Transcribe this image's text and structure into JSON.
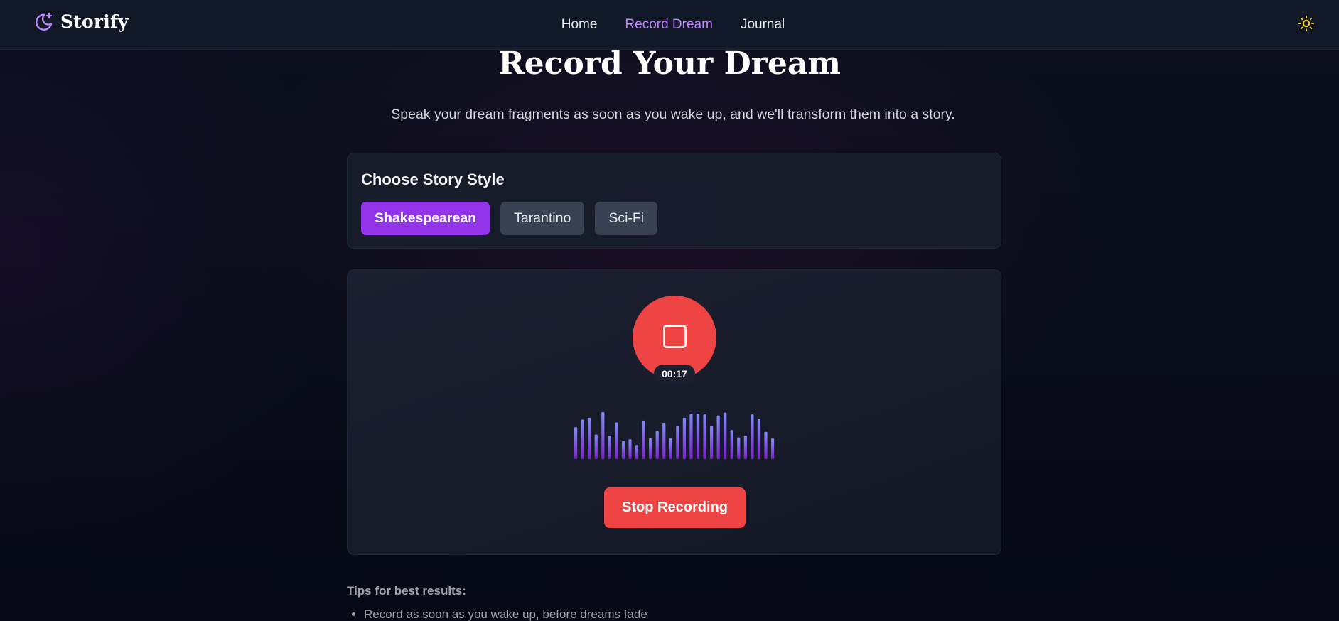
{
  "brand": {
    "name": "Storify",
    "icon": "moon-sparkle-icon",
    "color": "#c084fc"
  },
  "nav": {
    "items": [
      {
        "label": "Home",
        "active": false
      },
      {
        "label": "Record Dream",
        "active": true
      },
      {
        "label": "Journal",
        "active": false
      }
    ],
    "theme_toggle_icon": "sun-icon"
  },
  "main": {
    "title": "Record Your Dream",
    "subtitle": "Speak your dream fragments as soon as you wake up, and we'll transform them into a story."
  },
  "story_style": {
    "heading": "Choose Story Style",
    "options": [
      "Shakespearean",
      "Tarantino",
      "Sci-Fi"
    ],
    "selected": "Shakespearean"
  },
  "recorder": {
    "state": "recording",
    "stop_icon": "stop-square-icon",
    "timer": "00:17",
    "stop_label": "Stop Recording",
    "waveform_levels": [
      0.68,
      0.84,
      0.88,
      0.52,
      1.0,
      0.5,
      0.78,
      0.38,
      0.42,
      0.3,
      0.82,
      0.44,
      0.6,
      0.76,
      0.44,
      0.7,
      0.88,
      0.97,
      0.97,
      0.95,
      0.7,
      0.93,
      0.99,
      0.62,
      0.46,
      0.5,
      0.95,
      0.86,
      0.58,
      0.44
    ]
  },
  "tips": {
    "heading": "Tips for best results:",
    "items": [
      "Record as soon as you wake up, before dreams fade"
    ]
  },
  "colors": {
    "accent": "#9333ea",
    "nav_active": "#c084fc",
    "record": "#ef4444",
    "wave_top": "#818cf8",
    "wave_bottom": "#7e22ce"
  }
}
